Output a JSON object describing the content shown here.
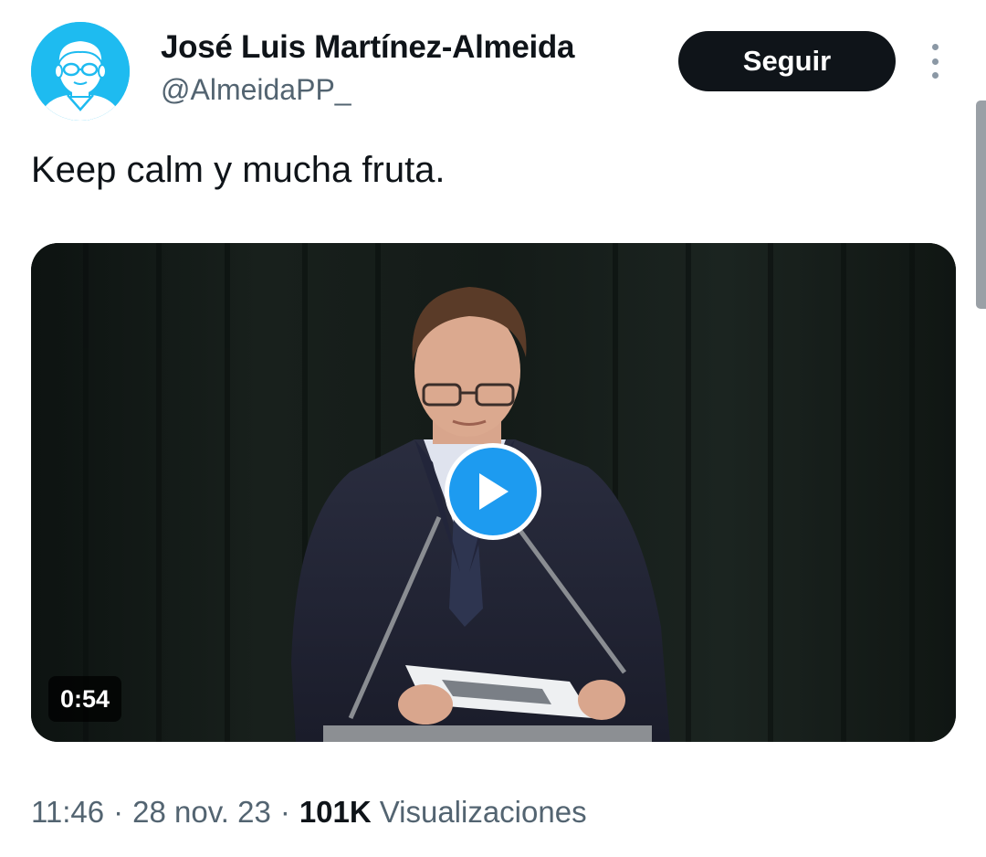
{
  "author": {
    "display_name": "José Luis Martínez-Almeida",
    "handle": "@AlmeidaPP_",
    "avatar_icon": "cartoon-face-with-glasses-icon",
    "avatar_color": "#1ebbf0"
  },
  "actions": {
    "follow_label": "Seguir",
    "more_icon": "vertical-ellipsis-icon"
  },
  "tweet": {
    "text": "Keep calm y mucha fruta."
  },
  "media": {
    "type": "video",
    "duration": "0:54",
    "play_icon": "play-icon",
    "play_color": "#1d9bf0"
  },
  "meta": {
    "time": "11:46",
    "separator": "·",
    "date": "28 nov. 23",
    "views_count": "101K",
    "views_label": "Visualizaciones"
  },
  "colors": {
    "text_primary": "#0f1419",
    "text_secondary": "#536471",
    "button_bg": "#0f1419"
  }
}
